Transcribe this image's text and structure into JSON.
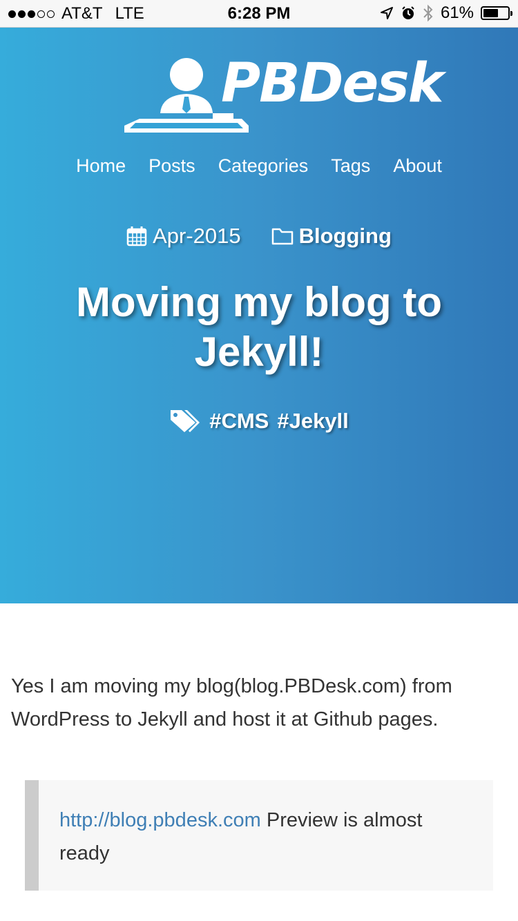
{
  "status_bar": {
    "carrier": "AT&T",
    "network": "LTE",
    "time": "6:28 PM",
    "battery_percent": "61%",
    "battery_level": 0.61,
    "signal_bars_filled": 3,
    "signal_bars_total": 5
  },
  "site": {
    "logo_text": "PBDesk"
  },
  "nav": {
    "items": [
      "Home",
      "Posts",
      "Categories",
      "Tags",
      "About"
    ]
  },
  "post": {
    "date": "Apr-2015",
    "category": "Blogging",
    "title": "Moving my blog to Jekyll!",
    "tags": [
      "#CMS",
      "#Jekyll"
    ],
    "body": "Yes I am moving my blog(blog.PBDesk.com) from WordPress to Jekyll and host it at Github pages.",
    "quote_link": "http://blog.pbdesk.com",
    "quote_text": " Preview is almost ready"
  },
  "colors": {
    "hero_gradient_start": "#36acdb",
    "hero_gradient_end": "#3078b8",
    "link": "#3f7fb5",
    "quote_bar": "#cccccc",
    "quote_bg": "#f7f7f7"
  },
  "icons": [
    "location-arrow-icon",
    "alarm-icon",
    "bluetooth-icon",
    "battery-icon",
    "calendar-icon",
    "folder-icon",
    "tags-icon"
  ]
}
